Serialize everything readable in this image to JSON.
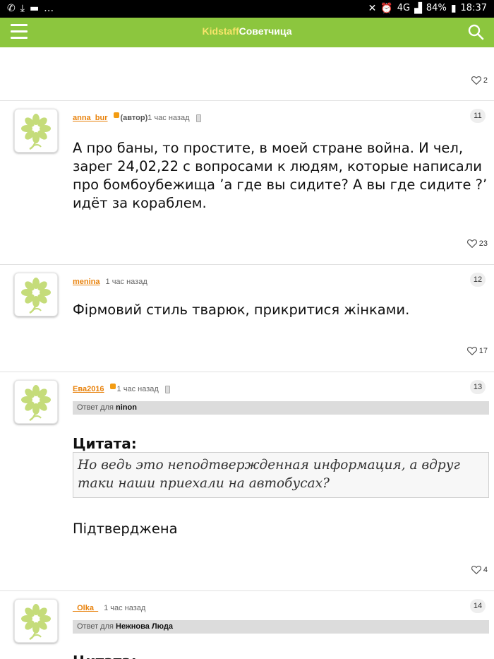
{
  "status_bar": {
    "battery": "84%",
    "time": "18:37",
    "network": "4G",
    "left_icons": [
      "whatsapp-icon",
      "download-icon",
      "message-icon",
      "more-dots-icon"
    ],
    "right_icons": [
      "mute-icon",
      "alarm-icon",
      "signal-icon",
      "battery-icon"
    ]
  },
  "app_bar": {
    "brand_part1": "Kidstaff",
    "brand_part2": "Советчица",
    "colors": {
      "bar": "#8cc63e",
      "brand1": "#f7e56a",
      "brand2": "#ffffff"
    }
  },
  "top_post": {
    "likes": "2"
  },
  "posts": [
    {
      "username": "anna_bur",
      "author_tag": "(автор)",
      "time": "1 час назад",
      "number": "11",
      "text": "А про баны, то простите, в моей стране война. И чел, зарег 24,02,22 с вопросами к людям, которые написали про бомбоубежища ’а где вы сидите? А вы где сидите ?’ идёт за кораблем.",
      "likes": "23"
    },
    {
      "username": "menina",
      "time": "1 час назад",
      "number": "12",
      "text": "Фірмовий стиль тварюк, прикритися жінками.",
      "likes": "17"
    },
    {
      "username": "Ева2016",
      "time": "1 час назад",
      "number": "13",
      "reply_prefix": "Ответ для",
      "reply_to": "ninon",
      "quote_title": "Цитата:",
      "quote_text": "Но ведь это неподтвержденная информация, а вдруг таки наши приехали на автобусах?",
      "text": "Підтверджена",
      "likes": "4"
    },
    {
      "username": "_Olka_",
      "time": "1 час назад",
      "number": "14",
      "reply_prefix": "Ответ для",
      "reply_to": "Нежнова Люда",
      "quote_title": "Цитата:"
    }
  ]
}
